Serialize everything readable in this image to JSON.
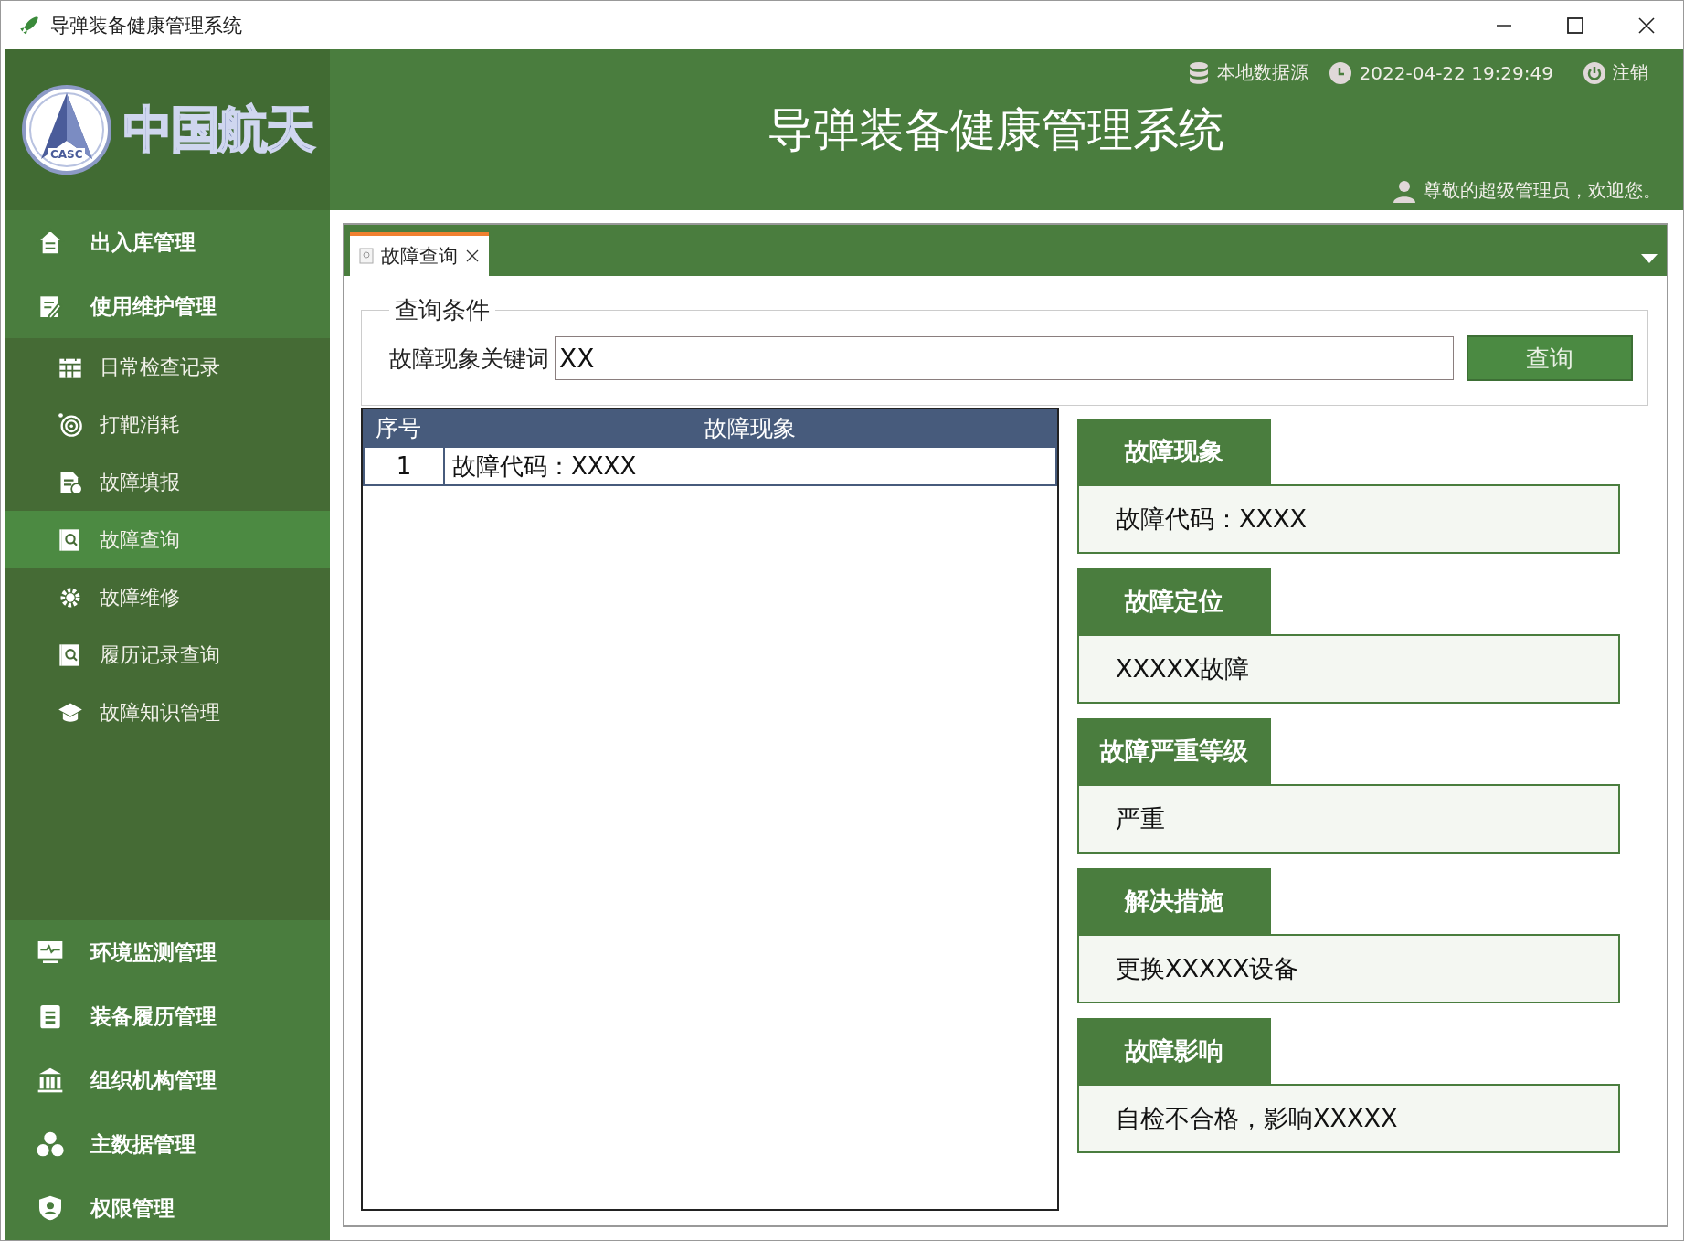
{
  "window": {
    "title": "导弹装备健康管理系统"
  },
  "header": {
    "logo_text": "中国航天",
    "logo_badge": "CASC",
    "data_source": "本地数据源",
    "datetime": "2022-04-22 19:29:49",
    "logout": "注销",
    "title": "导弹装备健康管理系统",
    "welcome": "尊敬的超级管理员，欢迎您。"
  },
  "sidebar": {
    "items": [
      {
        "label": "出入库管理",
        "selected": false
      },
      {
        "label": "使用维护管理",
        "selected": false,
        "children": [
          {
            "label": "日常检查记录",
            "selected": false
          },
          {
            "label": "打靶消耗",
            "selected": false
          },
          {
            "label": "故障填报",
            "selected": false
          },
          {
            "label": "故障查询",
            "selected": true
          },
          {
            "label": "故障维修",
            "selected": false
          },
          {
            "label": "履历记录查询",
            "selected": false
          },
          {
            "label": "故障知识管理",
            "selected": false
          }
        ]
      },
      {
        "label": "环境监测管理",
        "selected": false
      },
      {
        "label": "装备履历管理",
        "selected": false
      },
      {
        "label": "组织机构管理",
        "selected": false
      },
      {
        "label": "主数据管理",
        "selected": false
      },
      {
        "label": "权限管理",
        "selected": false
      }
    ]
  },
  "tabs": [
    {
      "label": "故障查询",
      "selected": true
    }
  ],
  "query": {
    "group_title": "查询条件",
    "field_label": "故障现象关键词",
    "field_value": "XX",
    "button": "查询"
  },
  "table": {
    "columns": [
      "序号",
      "故障现象"
    ],
    "rows": [
      {
        "cells": [
          "1",
          "故障代码：XXXX"
        ],
        "selected": true
      }
    ]
  },
  "details": [
    {
      "heading": "故障现象",
      "value": "故障代码：XXXX"
    },
    {
      "heading": "故障定位",
      "value": "XXXXX故障"
    },
    {
      "heading": "故障严重等级",
      "value": "严重"
    },
    {
      "heading": "解决措施",
      "value": "更换XXXXX设备"
    },
    {
      "heading": "故障影响",
      "value": "自检不合格，影响XXXXX"
    }
  ]
}
